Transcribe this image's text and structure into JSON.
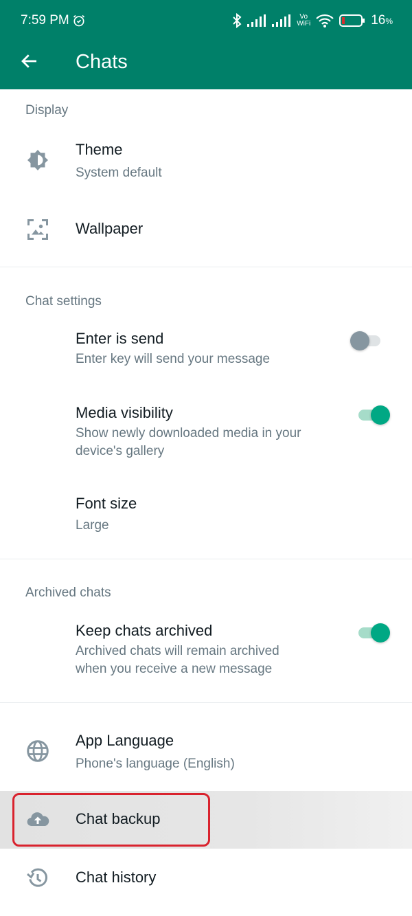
{
  "status_bar": {
    "time": "7:59 PM",
    "alarm_icon": "alarm-clock-icon",
    "icons": [
      "bluetooth-icon",
      "signal-icon",
      "signal-icon",
      "vowifi-icon",
      "wifi-icon",
      "battery-low-icon"
    ],
    "vowifi_top": "Vo",
    "vowifi_bottom": "WiFi",
    "battery_percent": "16",
    "battery_suffix": "%"
  },
  "app_bar": {
    "back_icon": "arrow-left-icon",
    "title": "Chats"
  },
  "sections": {
    "display": {
      "header": "Display",
      "theme": {
        "title": "Theme",
        "subtitle": "System default",
        "icon": "brightness-icon"
      },
      "wallpaper": {
        "title": "Wallpaper",
        "icon": "wallpaper-icon"
      }
    },
    "chat_settings": {
      "header": "Chat settings",
      "enter_is_send": {
        "title": "Enter is send",
        "subtitle": "Enter key will send your message",
        "enabled": false
      },
      "media_visibility": {
        "title": "Media visibility",
        "subtitle_line1": "Show newly downloaded media in your",
        "subtitle_line2": "device's gallery",
        "enabled": true
      },
      "font_size": {
        "title": "Font size",
        "subtitle": "Large"
      }
    },
    "archived_chats": {
      "header": "Archived chats",
      "keep_archived": {
        "title": "Keep chats archived",
        "subtitle_line1": "Archived chats will remain archived",
        "subtitle_line2": "when you receive a new message",
        "enabled": true
      }
    },
    "other": {
      "app_language": {
        "title": "App Language",
        "subtitle": "Phone's language (English)",
        "icon": "globe-icon"
      },
      "chat_backup": {
        "title": "Chat backup",
        "icon": "cloud-upload-icon",
        "highlighted": true
      },
      "chat_history": {
        "title": "Chat history",
        "icon": "history-icon"
      }
    }
  },
  "colors": {
    "brand": "#008069",
    "accent": "#00a884",
    "highlight_box": "#d9232e",
    "icon_gray": "#8696a0"
  }
}
